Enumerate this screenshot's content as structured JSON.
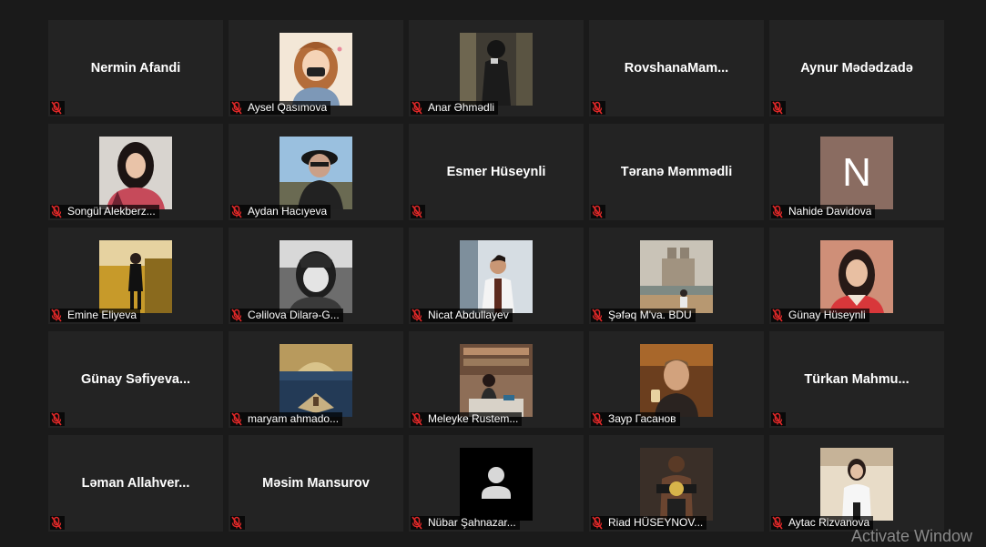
{
  "participants": [
    {
      "name": "Nermin Afandi",
      "display": "center"
    },
    {
      "name": "Aysel Qasımova",
      "display": "photo",
      "photo": "cartoon-girl-avatar"
    },
    {
      "name": "Anar Əhmədli",
      "display": "photo",
      "photo": "person-in-dark-photo"
    },
    {
      "name": "RovshanaMam...",
      "display": "center"
    },
    {
      "name": "Aynur Mədədzadə",
      "display": "center"
    },
    {
      "name": "Songül Alekberz...",
      "display": "photo",
      "photo": "girl-portrait-photo"
    },
    {
      "name": "Aydan Hacıyeva",
      "display": "photo",
      "photo": "person-with-hat-photo"
    },
    {
      "name": "Esmer Hüseynli",
      "display": "center"
    },
    {
      "name": "Təranə Məmmədli",
      "display": "center"
    },
    {
      "name": "Nahide Davidova",
      "display": "letter",
      "letter": "N",
      "color": "#8a6c61"
    },
    {
      "name": "Emine Eliyeva",
      "display": "photo",
      "photo": "girl-yellow-photo"
    },
    {
      "name": "Cəlilova Dilarə-G...",
      "display": "photo",
      "photo": "bw-portrait-photo"
    },
    {
      "name": "Nicat Abdullayev",
      "display": "photo",
      "photo": "man-lab-photo"
    },
    {
      "name": "Şəfəq M'va. BDU",
      "display": "photo",
      "photo": "cathedral-photo"
    },
    {
      "name": "Günay Hüseynli",
      "display": "photo",
      "photo": "woman-portrait-photo"
    },
    {
      "name": "Günay  Səfiyeva...",
      "display": "center"
    },
    {
      "name": "maryam ahmado...",
      "display": "photo",
      "photo": "mosque-quran-photo"
    },
    {
      "name": "Meleyke Rustem...",
      "display": "photo",
      "photo": "library-photo"
    },
    {
      "name": "Заур Гасанов",
      "display": "photo",
      "photo": "laughing-man-photo"
    },
    {
      "name": "Türkan  Mahmu...",
      "display": "center"
    },
    {
      "name": "Ləman  Allahver...",
      "display": "center"
    },
    {
      "name": "Məsim Mansurov",
      "display": "center"
    },
    {
      "name": "Nübar Şahnazar...",
      "display": "photo",
      "photo": "default-user-avatar"
    },
    {
      "name": "Riad HÜSEYNOV...",
      "display": "photo",
      "photo": "fighter-belt-photo"
    },
    {
      "name": "Aytac Rizvanova",
      "display": "photo",
      "photo": "woman-white-photo"
    }
  ],
  "muted_icon": "muted-mic-icon",
  "colors": {
    "muted": "#e02828",
    "tile": "#232323",
    "background": "#1a1a1a"
  },
  "watermark": "Activate Window"
}
